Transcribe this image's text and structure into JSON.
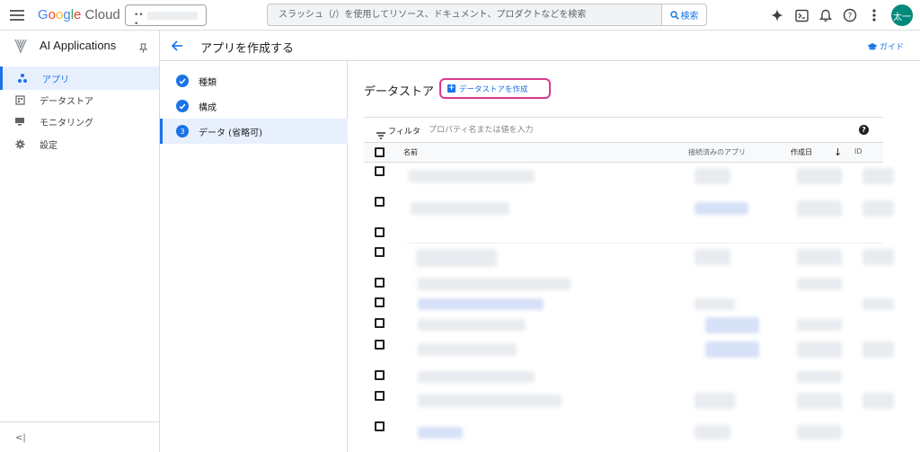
{
  "topbar": {
    "logo": "Google Cloud",
    "search_placeholder": "スラッシュ（/）を使用してリソース、ドキュメント、プロダクトなどを検索",
    "search_button": "検索",
    "avatar_text": "太一",
    "icons": [
      "menu-icon",
      "project-icon",
      "gemini-icon",
      "cloud-shell-icon",
      "notifications-icon",
      "help-icon",
      "more-vert-icon"
    ]
  },
  "leftnav": {
    "product_title": "AI Applications",
    "items": [
      {
        "label": "アプリ",
        "icon": "apps-icon",
        "active": true
      },
      {
        "label": "データストア",
        "icon": "datastore-icon",
        "active": false
      },
      {
        "label": "モニタリング",
        "icon": "monitoring-icon",
        "active": false
      },
      {
        "label": "設定",
        "icon": "settings-icon",
        "active": false
      }
    ],
    "collapse_label": "<|"
  },
  "subheader": {
    "title": "アプリを作成する",
    "guide_label": "ガイド"
  },
  "stepper": {
    "steps": [
      {
        "label": "種類",
        "state": "done"
      },
      {
        "label": "構成",
        "state": "done"
      },
      {
        "label": "データ (省略可)",
        "state": "active",
        "number": "3"
      }
    ]
  },
  "main": {
    "section_title": "データストア",
    "create_button": "データストアを作成",
    "filter_label": "フィルタ",
    "filter_placeholder": "プロパティ名または値を入力",
    "help_glyph": "?",
    "columns": {
      "name": "名前",
      "connected_apps": "接続済みのアプリ",
      "created": "作成日",
      "id": "ID"
    },
    "sort_indicator": "↓"
  },
  "colors": {
    "accent": "#1a73e8",
    "highlight_border": "#d93a8b",
    "avatar_bg": "#00897b"
  }
}
